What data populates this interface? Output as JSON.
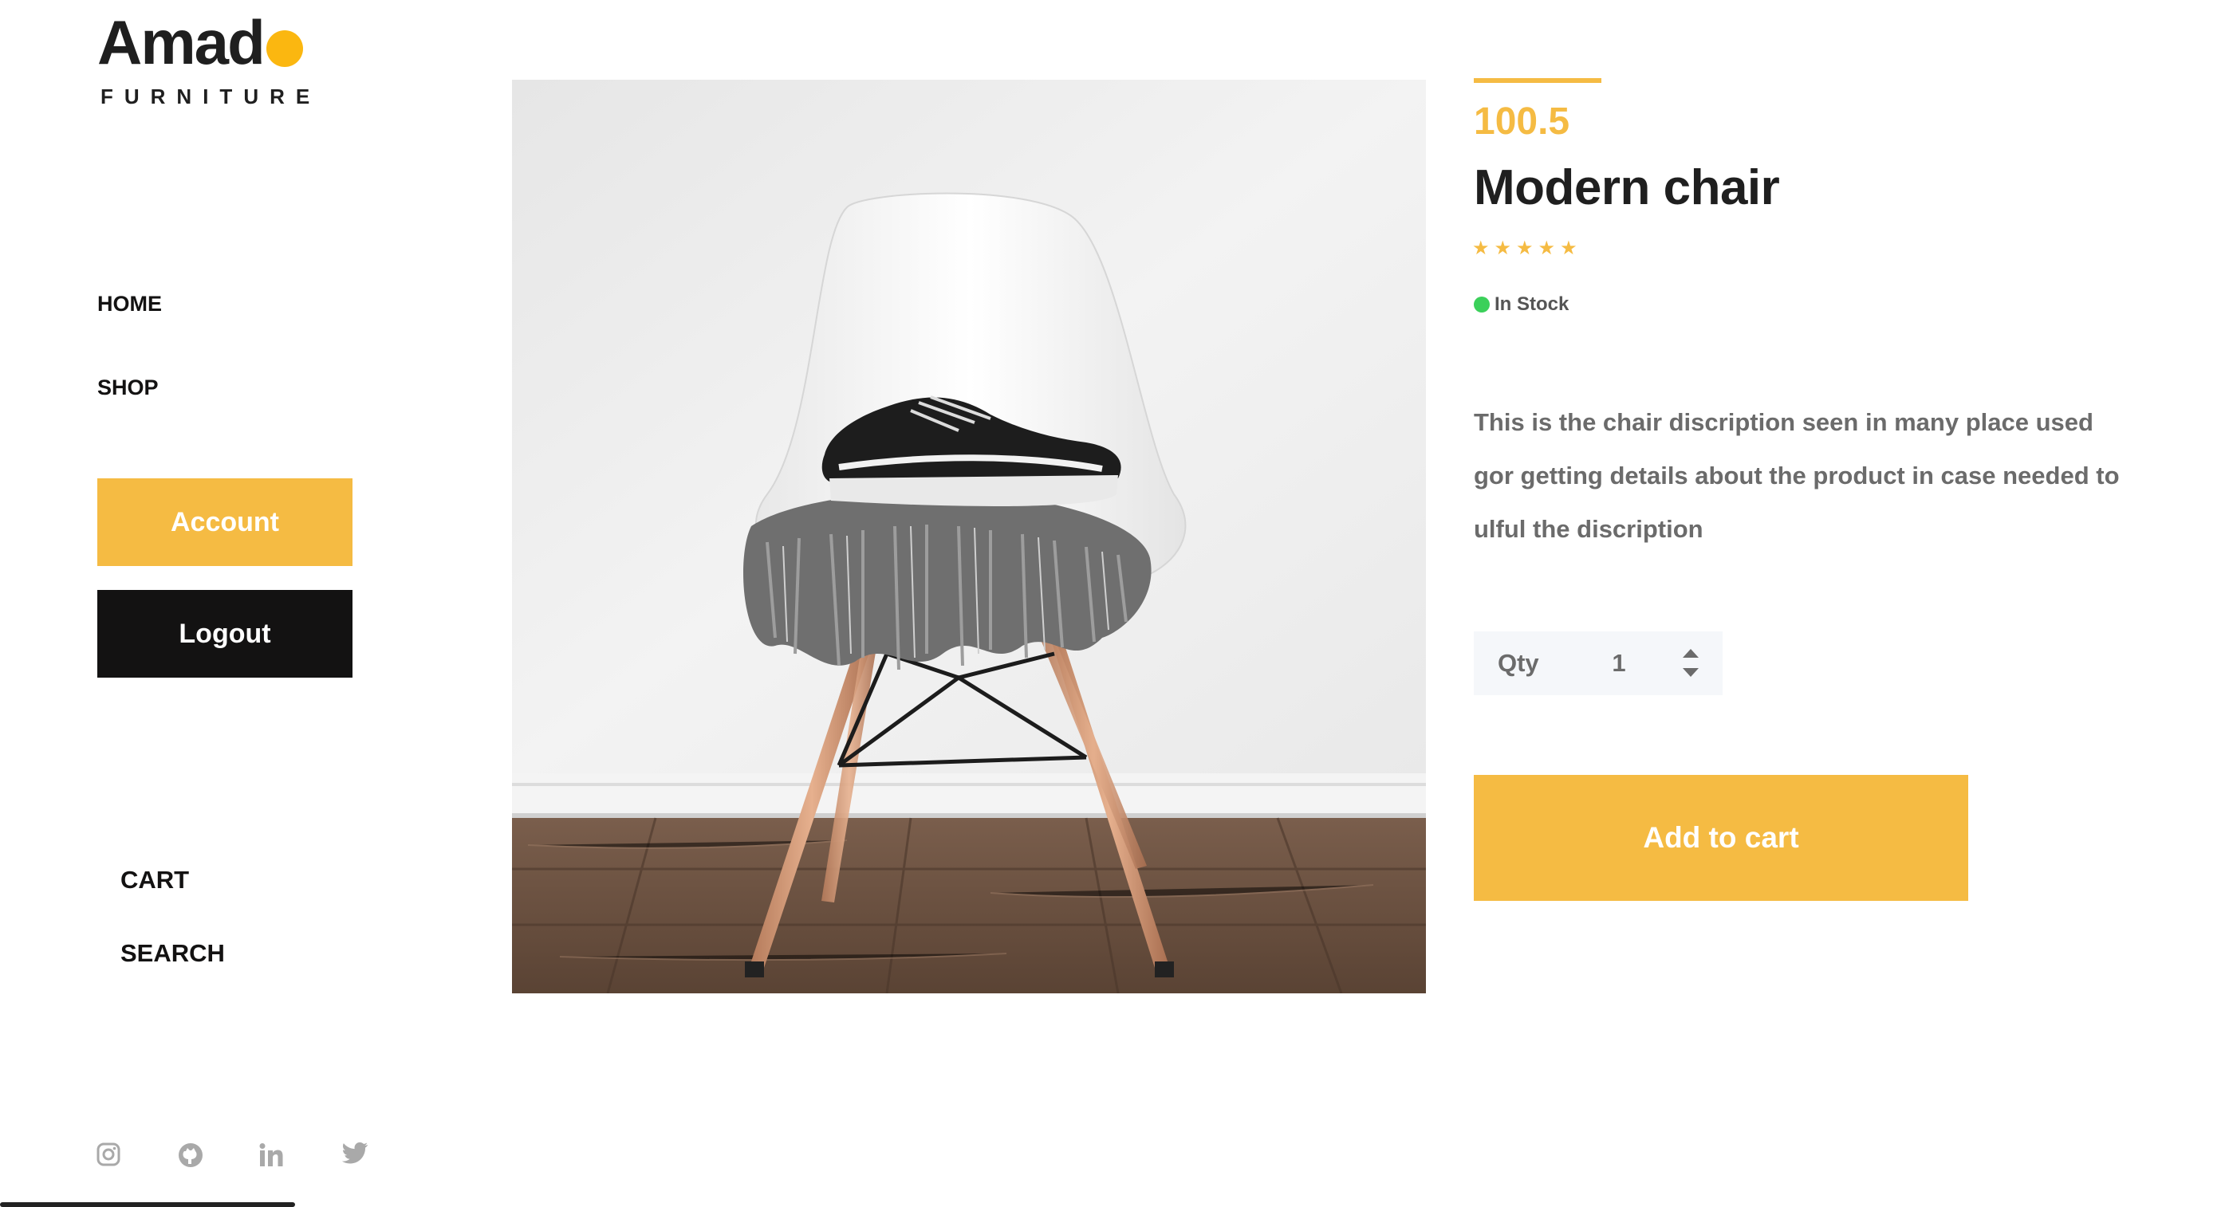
{
  "brand": {
    "name": "Amado",
    "name_main": "Amad",
    "tagline": "FURNITURE",
    "accent_color": "#f5bb43"
  },
  "nav": {
    "home": "HOME",
    "shop": "SHOP",
    "account": "Account",
    "logout": "Logout",
    "cart": "CART",
    "search": "SEARCH"
  },
  "social": [
    "instagram-icon",
    "github-icon",
    "linkedin-icon",
    "twitter-icon"
  ],
  "product": {
    "price": "100.5",
    "title": "Modern chair",
    "rating": 5,
    "rating_max": 5,
    "stock": "In Stock",
    "stock_color": "#3bd05a",
    "description": "This is the chair discription seen in many place used gor getting details about the product in case needed to ulful the discription",
    "image_alt": "white chair with sneakers and a fringed blanket"
  },
  "qty": {
    "label": "Qty",
    "value": "1"
  },
  "actions": {
    "add_to_cart": "Add to cart"
  }
}
